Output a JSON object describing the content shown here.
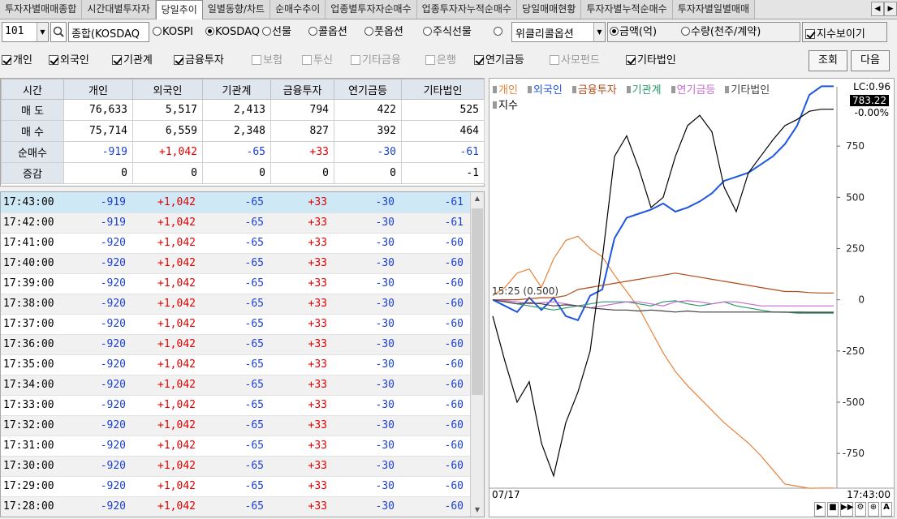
{
  "tabs": [
    "투자자별매매종합",
    "시간대별투자자",
    "당일추이",
    "일별동향/차트",
    "순매수추이",
    "업종별투자자순매수",
    "업종투자자누적순매수",
    "당일매매현황",
    "투자자별누적순매수",
    "투자자별일별매매"
  ],
  "active_tab": 2,
  "controls": {
    "code": "101",
    "market_select": "종합(KOSDAQ",
    "radios": [
      {
        "label": "KOSPI",
        "on": false
      },
      {
        "label": "KOSDAQ",
        "on": true
      },
      {
        "label": "선물",
        "on": false
      },
      {
        "label": "콜옵션",
        "on": false
      },
      {
        "label": "풋옵션",
        "on": false
      },
      {
        "label": "주식선물",
        "on": false
      },
      {
        "label": "",
        "on": false
      }
    ],
    "option_select": "위클리콜옵션",
    "unit_radios": [
      {
        "label": "금액(억)",
        "on": true
      },
      {
        "label": "수량(천주/계약)",
        "on": false
      }
    ],
    "show_index_label": "지수보이기",
    "show_index": true
  },
  "investor_checks": [
    {
      "label": "개인",
      "on": true,
      "enabled": true
    },
    {
      "label": "외국인",
      "on": true,
      "enabled": true
    },
    {
      "label": "기관계",
      "on": true,
      "enabled": true
    },
    {
      "label": "금융투자",
      "on": true,
      "enabled": true
    },
    {
      "label": "보험",
      "on": false,
      "enabled": false
    },
    {
      "label": "투신",
      "on": false,
      "enabled": false
    },
    {
      "label": "기타금융",
      "on": false,
      "enabled": false
    },
    {
      "label": "은행",
      "on": false,
      "enabled": false
    },
    {
      "label": "연기금등",
      "on": true,
      "enabled": true
    },
    {
      "label": "사모펀드",
      "on": false,
      "enabled": false
    },
    {
      "label": "기타법인",
      "on": true,
      "enabled": true
    }
  ],
  "buttons": {
    "query": "조회",
    "next": "다음"
  },
  "summary": {
    "headers": [
      "시간",
      "개인",
      "외국인",
      "기관계",
      "금융투자",
      "연기금등",
      "기타법인"
    ],
    "rows": [
      {
        "label": "매  도",
        "values": [
          "76,633",
          "5,517",
          "2,413",
          "794",
          "422",
          "525"
        ]
      },
      {
        "label": "매  수",
        "values": [
          "75,714",
          "6,559",
          "2,348",
          "827",
          "392",
          "464"
        ]
      },
      {
        "label": "순매수",
        "values": [
          "-919",
          "+1,042",
          "-65",
          "+33",
          "-30",
          "-61"
        ]
      },
      {
        "label": "증감",
        "values": [
          "0",
          "0",
          "0",
          "0",
          "0",
          "-1"
        ]
      }
    ]
  },
  "timeseries": [
    {
      "time": "17:43:00",
      "values": [
        "-919",
        "+1,042",
        "-65",
        "+33",
        "-30",
        "-61"
      ]
    },
    {
      "time": "17:42:00",
      "values": [
        "-919",
        "+1,042",
        "-65",
        "+33",
        "-30",
        "-61"
      ]
    },
    {
      "time": "17:41:00",
      "values": [
        "-920",
        "+1,042",
        "-65",
        "+33",
        "-30",
        "-60"
      ]
    },
    {
      "time": "17:40:00",
      "values": [
        "-920",
        "+1,042",
        "-65",
        "+33",
        "-30",
        "-60"
      ]
    },
    {
      "time": "17:39:00",
      "values": [
        "-920",
        "+1,042",
        "-65",
        "+33",
        "-30",
        "-60"
      ]
    },
    {
      "time": "17:38:00",
      "values": [
        "-920",
        "+1,042",
        "-65",
        "+33",
        "-30",
        "-60"
      ]
    },
    {
      "time": "17:37:00",
      "values": [
        "-920",
        "+1,042",
        "-65",
        "+33",
        "-30",
        "-60"
      ]
    },
    {
      "time": "17:36:00",
      "values": [
        "-920",
        "+1,042",
        "-65",
        "+33",
        "-30",
        "-60"
      ]
    },
    {
      "time": "17:35:00",
      "values": [
        "-920",
        "+1,042",
        "-65",
        "+33",
        "-30",
        "-60"
      ]
    },
    {
      "time": "17:34:00",
      "values": [
        "-920",
        "+1,042",
        "-65",
        "+33",
        "-30",
        "-60"
      ]
    },
    {
      "time": "17:33:00",
      "values": [
        "-920",
        "+1,042",
        "-65",
        "+33",
        "-30",
        "-60"
      ]
    },
    {
      "time": "17:32:00",
      "values": [
        "-920",
        "+1,042",
        "-65",
        "+33",
        "-30",
        "-60"
      ]
    },
    {
      "time": "17:31:00",
      "values": [
        "-920",
        "+1,042",
        "-65",
        "+33",
        "-30",
        "-60"
      ]
    },
    {
      "time": "17:30:00",
      "values": [
        "-920",
        "+1,042",
        "-65",
        "+33",
        "-30",
        "-60"
      ]
    },
    {
      "time": "17:29:00",
      "values": [
        "-920",
        "+1,042",
        "-65",
        "+33",
        "-30",
        "-60"
      ]
    },
    {
      "time": "17:28:00",
      "values": [
        "-920",
        "+1,042",
        "-65",
        "+33",
        "-30",
        "-60"
      ]
    }
  ],
  "chart": {
    "legend": [
      {
        "label": "개인",
        "color": "#e8823a"
      },
      {
        "label": "외국인",
        "color": "#1e56e0"
      },
      {
        "label": "금융투자",
        "color": "#b04a18"
      },
      {
        "label": "기관계",
        "color": "#2a9a6a"
      },
      {
        "label": "연기금등",
        "color": "#c46ad0"
      },
      {
        "label": "기타법인",
        "color": "#404040"
      },
      {
        "label": "지수",
        "color": "#000000"
      }
    ],
    "lc_label": "LC:0.96",
    "index_value": "783.22",
    "index_change": "-0.00%",
    "y_ticks": [
      "750",
      "500",
      "250",
      "0",
      "-250",
      "-500",
      "-750"
    ],
    "annotation": "15:25 (0.500)",
    "start_date": "07/17",
    "end_time": "17:43:00"
  },
  "chart_data": {
    "type": "line",
    "ylim": [
      -900,
      1000
    ],
    "series": [
      {
        "name": "개인",
        "color": "#e8823a",
        "values": [
          20,
          60,
          130,
          150,
          60,
          200,
          290,
          310,
          250,
          210,
          120,
          40,
          -40,
          -150,
          -260,
          -350,
          -420,
          -480,
          -540,
          -600,
          -650,
          -700,
          -760,
          -830,
          -900,
          -910,
          -920,
          -919,
          -919
        ]
      },
      {
        "name": "외국인",
        "color": "#1e56e0",
        "values": [
          0,
          -30,
          -60,
          10,
          -50,
          10,
          -80,
          -100,
          20,
          50,
          300,
          400,
          420,
          440,
          470,
          430,
          450,
          480,
          520,
          580,
          600,
          620,
          660,
          700,
          760,
          850,
          1000,
          1042,
          1042
        ]
      },
      {
        "name": "금융투자",
        "color": "#b04a18",
        "values": [
          0,
          0,
          0,
          5,
          10,
          10,
          20,
          50,
          60,
          70,
          80,
          90,
          100,
          110,
          120,
          130,
          120,
          110,
          100,
          90,
          80,
          70,
          60,
          50,
          40,
          40,
          35,
          33,
          33
        ]
      },
      {
        "name": "기관계",
        "color": "#2a9a6a",
        "values": [
          0,
          -10,
          -20,
          -30,
          -40,
          -50,
          -40,
          -30,
          -20,
          -10,
          -10,
          -10,
          -20,
          -30,
          -10,
          -5,
          -20,
          -30,
          -20,
          -10,
          -30,
          -40,
          -50,
          -60,
          -60,
          -65,
          -65,
          -65,
          -65
        ]
      },
      {
        "name": "연기금등",
        "color": "#c46ad0",
        "values": [
          0,
          -5,
          -10,
          -20,
          -15,
          -10,
          -20,
          -30,
          -40,
          -30,
          -20,
          -10,
          -10,
          -20,
          -30,
          -10,
          -5,
          -10,
          -20,
          -10,
          -10,
          -20,
          -30,
          -30,
          -30,
          -30,
          -30,
          -30,
          -30
        ]
      },
      {
        "name": "기타법인",
        "color": "#404040",
        "values": [
          0,
          -10,
          -20,
          -15,
          -20,
          -30,
          -25,
          -30,
          -40,
          -45,
          -50,
          -50,
          -55,
          -50,
          -55,
          -60,
          -55,
          -60,
          -60,
          -60,
          -60,
          -60,
          -60,
          -60,
          -61,
          -60,
          -61,
          -61,
          -61
        ]
      },
      {
        "name": "지수",
        "color": "#000000",
        "values": [
          -80,
          -300,
          -500,
          -400,
          -700,
          -860,
          -600,
          -450,
          -250,
          200,
          700,
          800,
          640,
          450,
          500,
          700,
          850,
          900,
          820,
          550,
          430,
          620,
          700,
          780,
          850,
          880,
          920,
          930,
          930
        ]
      }
    ]
  }
}
